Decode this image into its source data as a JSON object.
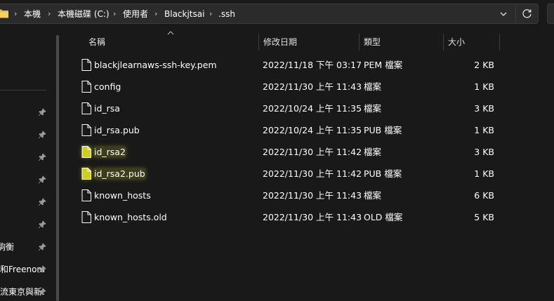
{
  "address_bar": {
    "crumbs": [
      "本機",
      "本機磁碟 (C:)",
      "使用者",
      "Blackjtsai",
      ".ssh"
    ],
    "separator": "›"
  },
  "nav": {
    "items": [
      {
        "label": "",
        "pinned": true
      },
      {
        "label": "",
        "pinned": true
      },
      {
        "label": "",
        "pinned": true
      },
      {
        "label": "",
        "pinned": true
      },
      {
        "label": "",
        "pinned": true
      },
      {
        "label": "",
        "pinned": true
      },
      {
        "label": "駒衡",
        "pinned": true
      },
      {
        "label": "和Freenom",
        "pinned": true
      },
      {
        "label": "流東京與新:",
        "pinned": true
      }
    ]
  },
  "columns": {
    "name": "名稱",
    "date": "修改日期",
    "type": "類型",
    "size": "大小"
  },
  "files": [
    {
      "name": "blackjlearnaws-ssh-key.pem",
      "date": "2022/11/18 下午 03:17",
      "type": "PEM 檔案",
      "size": "2 KB",
      "highlight": false
    },
    {
      "name": "config",
      "date": "2022/11/30 上午 11:43",
      "type": "檔案",
      "size": "1 KB",
      "highlight": false
    },
    {
      "name": "id_rsa",
      "date": "2022/10/24 上午 11:35",
      "type": "檔案",
      "size": "3 KB",
      "highlight": false
    },
    {
      "name": "id_rsa.pub",
      "date": "2022/10/24 上午 11:35",
      "type": "PUB 檔案",
      "size": "1 KB",
      "highlight": false
    },
    {
      "name": "id_rsa2",
      "date": "2022/11/30 上午 11:42",
      "type": "檔案",
      "size": "3 KB",
      "highlight": true
    },
    {
      "name": "id_rsa2.pub",
      "date": "2022/11/30 上午 11:42",
      "type": "PUB 檔案",
      "size": "1 KB",
      "highlight": true
    },
    {
      "name": "known_hosts",
      "date": "2022/11/30 上午 11:43",
      "type": "檔案",
      "size": "6 KB",
      "highlight": false
    },
    {
      "name": "known_hosts.old",
      "date": "2022/11/30 上午 11:43",
      "type": "OLD 檔案",
      "size": "5 KB",
      "highlight": false
    }
  ],
  "colors": {
    "background": "#191919",
    "highlight": "#e6e628"
  }
}
